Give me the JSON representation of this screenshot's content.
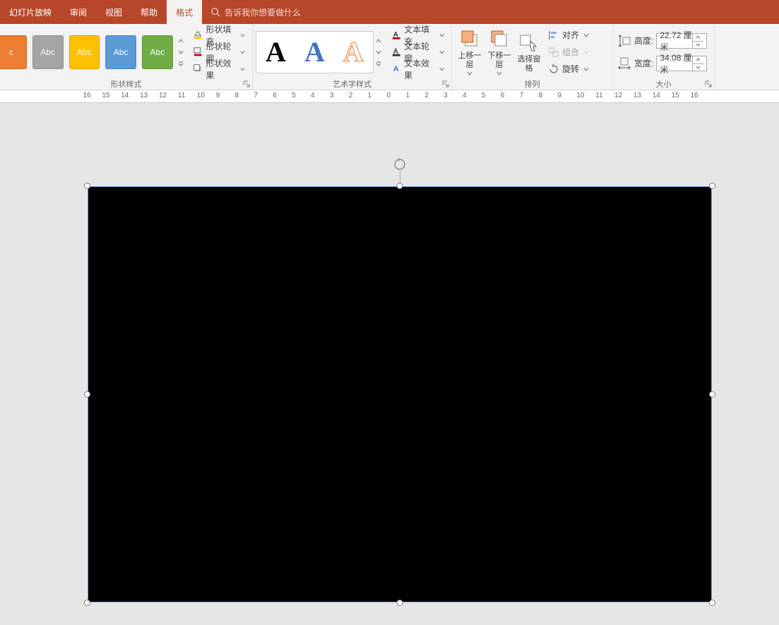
{
  "tabs": {
    "slideshow": "幻灯片放映",
    "review": "审阅",
    "view": "视图",
    "help": "帮助",
    "format": "格式"
  },
  "tell_me": {
    "placeholder": "告诉我你想要做什么"
  },
  "groups": {
    "shape_styles": "形状样式",
    "wordart_styles": "艺术字样式",
    "arrange": "排列",
    "size": "大小"
  },
  "swatch_label": "Abc",
  "swatch_label_partial": "c",
  "shape_fill": "形状填充",
  "shape_outline": "形状轮廓",
  "shape_effects": "形状效果",
  "wordart_letter": "A",
  "text_fill": "文本填充",
  "text_outline": "文本轮廓",
  "text_effects": "文本效果",
  "bring_forward": "上移一层",
  "send_backward": "下移一层",
  "selection_pane": "选择窗格",
  "align": "对齐",
  "group_btn": "组合",
  "rotate": "旋转",
  "height_label": "高度:",
  "width_label": "宽度:",
  "height_value": "22.72 厘米",
  "width_value": "34.08 厘米",
  "ruler_marks": [
    "16",
    "15",
    "14",
    "13",
    "12",
    "11",
    "10",
    "9",
    "8",
    "7",
    "6",
    "5",
    "4",
    "3",
    "2",
    "1",
    "0",
    "1",
    "2",
    "3",
    "4",
    "5",
    "6",
    "7",
    "8",
    "9",
    "10",
    "11",
    "12",
    "13",
    "14",
    "15",
    "16"
  ]
}
